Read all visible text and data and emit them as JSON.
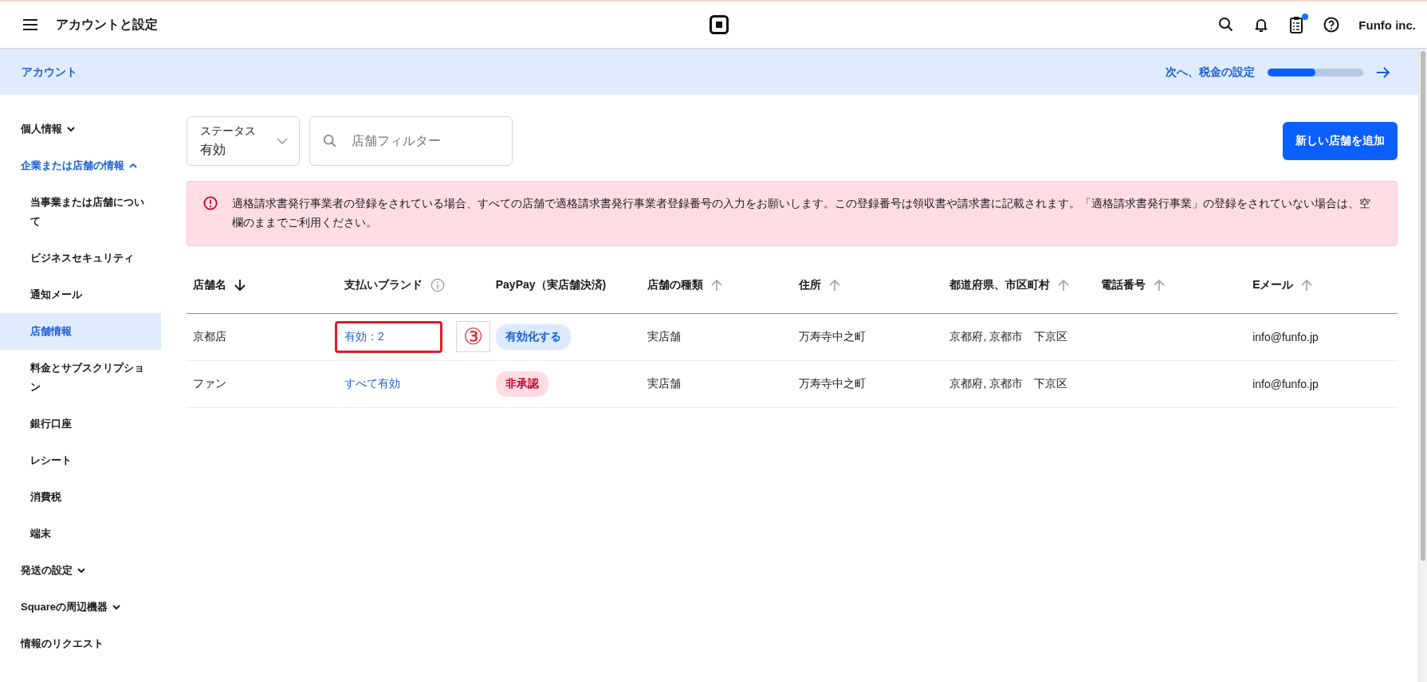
{
  "header": {
    "title": "アカウントと設定",
    "account": "Funfo inc.",
    "icons": [
      {
        "kind": "search",
        "dot": false
      },
      {
        "kind": "bell",
        "dot": false
      },
      {
        "kind": "clipboard",
        "dot": true
      },
      {
        "kind": "help",
        "dot": false
      }
    ]
  },
  "subheader": {
    "title": "アカウント",
    "next": "次へ、税金の設定",
    "progress": {
      "level": 0.5
    }
  },
  "sidebar": {
    "items": [
      {
        "label": "個人情報",
        "expanded": false,
        "selected": false
      },
      {
        "label": "企業または店舗の情報",
        "expanded": true,
        "selected": true,
        "children": [
          {
            "label": "当事業または店舗について",
            "selected": false
          },
          {
            "label": "ビジネスセキュリティ",
            "selected": false
          },
          {
            "label": "通知メール",
            "selected": false
          },
          {
            "label": "店舗情報",
            "selected": true
          },
          {
            "label": "料金とサブスクリプション",
            "selected": false
          },
          {
            "label": "銀行口座",
            "selected": false
          },
          {
            "label": "レシート",
            "selected": false
          },
          {
            "label": "消費税",
            "selected": false
          },
          {
            "label": "端末",
            "selected": false
          }
        ]
      },
      {
        "label": "発送の設定",
        "expanded": false,
        "selected": false
      },
      {
        "label": "Squareの周辺機器",
        "expanded": false,
        "selected": false
      },
      {
        "label": "情報のリクエスト",
        "selected": false
      }
    ]
  },
  "filters": {
    "status_label": "ステータス",
    "status_value": "有効",
    "search_placeholder": "店舗フィルター",
    "add_button": "新しい店舗を追加"
  },
  "alert": {
    "text": "適格請求書発行事業者の登録をされている場合、すべての店舗で適格請求書発行事業者登録番号の入力をお願いします。この登録番号は領収書や請求書に記載されます。「適格請求書発行事業」の登録をされていない場合は、空欄のままでご利用ください。"
  },
  "table": {
    "columns": [
      {
        "label": "店舗名",
        "kind": "sorted"
      },
      {
        "label": "支払いブランド",
        "kind": "info"
      },
      {
        "label": "PayPay（実店舗決済)",
        "kind": "plain"
      },
      {
        "label": "店舗の種類",
        "kind": "sortable"
      },
      {
        "label": "住所",
        "kind": "sortable"
      },
      {
        "label": "都道府県、市区町村",
        "kind": "sortable"
      },
      {
        "label": "電話番号",
        "kind": "sortable"
      },
      {
        "label": "Eメール",
        "kind": "sortable"
      }
    ],
    "rows": [
      {
        "name": "京都店",
        "brands": "有効：2",
        "brands_highlighted": true,
        "annotation": "③",
        "paypay": {
          "label": "有効化する",
          "kind": "enable"
        },
        "type": "実店舗",
        "address": "万寿寺中之町",
        "city": "京都府, 京都市　下京区",
        "email": "info@funfo.jp"
      },
      {
        "name": "ファン",
        "brands": "すべて有効",
        "brands_highlighted": false,
        "paypay": {
          "label": "非承認",
          "kind": "rejected"
        },
        "type": "実店舗",
        "address": "万寿寺中之町",
        "city": "京都府, 京都市　下京区",
        "email": "info@funfo.jp"
      }
    ]
  }
}
